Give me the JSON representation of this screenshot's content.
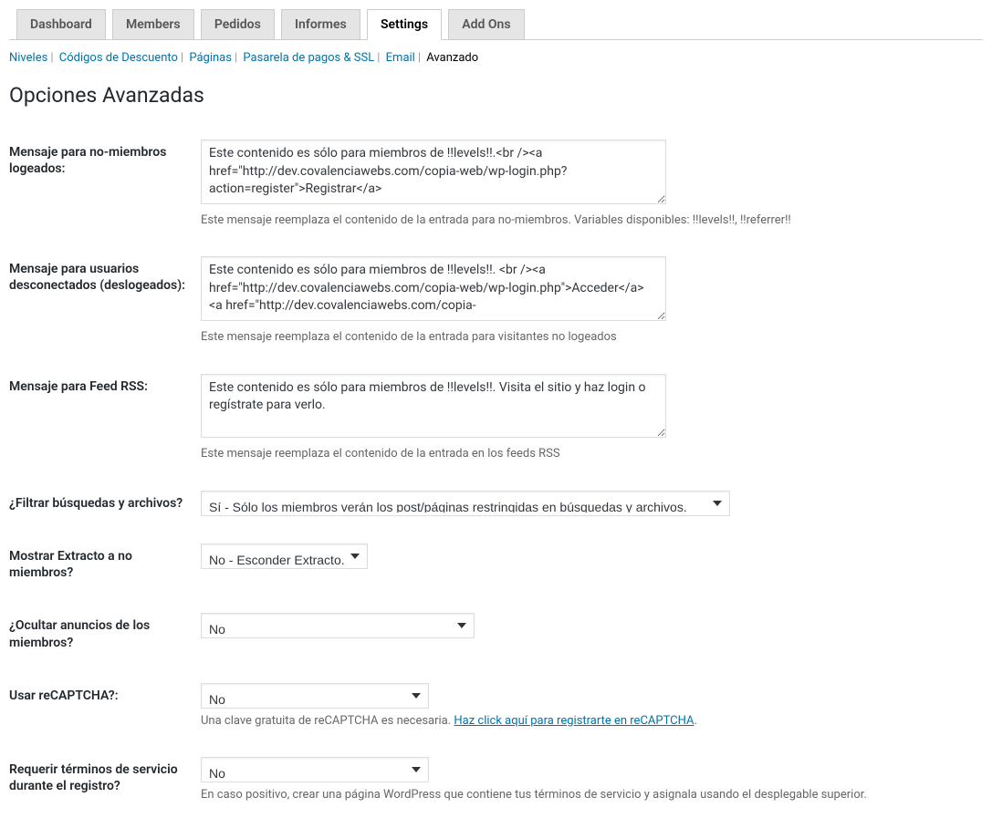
{
  "tabs": [
    {
      "label": "Dashboard",
      "active": false
    },
    {
      "label": "Members",
      "active": false
    },
    {
      "label": "Pedidos",
      "active": false
    },
    {
      "label": "Informes",
      "active": false
    },
    {
      "label": "Settings",
      "active": true
    },
    {
      "label": "Add Ons",
      "active": false
    }
  ],
  "subtabs": [
    {
      "label": "Niveles",
      "current": false
    },
    {
      "label": "Códigos de Descuento",
      "current": false
    },
    {
      "label": "Páginas",
      "current": false
    },
    {
      "label": "Pasarela de pagos & SSL",
      "current": false
    },
    {
      "label": "Email",
      "current": false
    },
    {
      "label": "Avanzado",
      "current": true
    }
  ],
  "page_title": "Opciones Avanzadas",
  "rows": {
    "nonmember": {
      "label": "Mensaje para no-miembros logeados:",
      "value": "Este contenido es sólo para miembros de !!levels!!.<br /><a href=\"http://dev.covalenciawebs.com/copia-web/wp-login.php?action=register\">Registrar</a>",
      "desc": "Este mensaje reemplaza el contenido de la entrada para no-miembros. Variables disponibles: !!levels!!, !!referrer!!"
    },
    "loggedout": {
      "label": "Mensaje para usuarios desconectados (deslogeados):",
      "value": "Este contenido es sólo para miembros de !!levels!!. <br /><a href=\"http://dev.covalenciawebs.com/copia-web/wp-login.php\">Acceder</a> <a href=\"http://dev.covalenciawebs.com/copia-",
      "desc": "Este mensaje reemplaza el contenido de la entrada para visitantes no logeados"
    },
    "rss": {
      "label": "Mensaje para Feed RSS:",
      "value": "Este contenido es sólo para miembros de !!levels!!. Visita el sitio y haz login o regístrate para verlo.",
      "desc": "Este mensaje reemplaza el contenido de la entrada en los feeds RSS"
    },
    "filter": {
      "label": "¿Filtrar búsquedas y archivos?",
      "value": "Sí - Sólo los miembros verán los post/páginas restringidas en búsquedas y archivos."
    },
    "excerpt": {
      "label": "Mostrar Extracto a no miembros?",
      "value": "No - Esconder Extracto."
    },
    "hideads": {
      "label": "¿Ocultar anuncios de los miembros?",
      "value": "No"
    },
    "recaptcha": {
      "label": "Usar reCAPTCHA?:",
      "value": "No",
      "desc_pre": "Una clave gratuita de reCAPTCHA es necesaria. ",
      "desc_link": "Haz click aquí para registrarte en reCAPTCHA",
      "desc_post": "."
    },
    "tos": {
      "label": "Requerir términos de servicio durante el registro?",
      "value": "No",
      "desc": "En caso positivo, crear una página WordPress que contiene tus términos de servicio y asignala usando el desplegable superior."
    }
  }
}
